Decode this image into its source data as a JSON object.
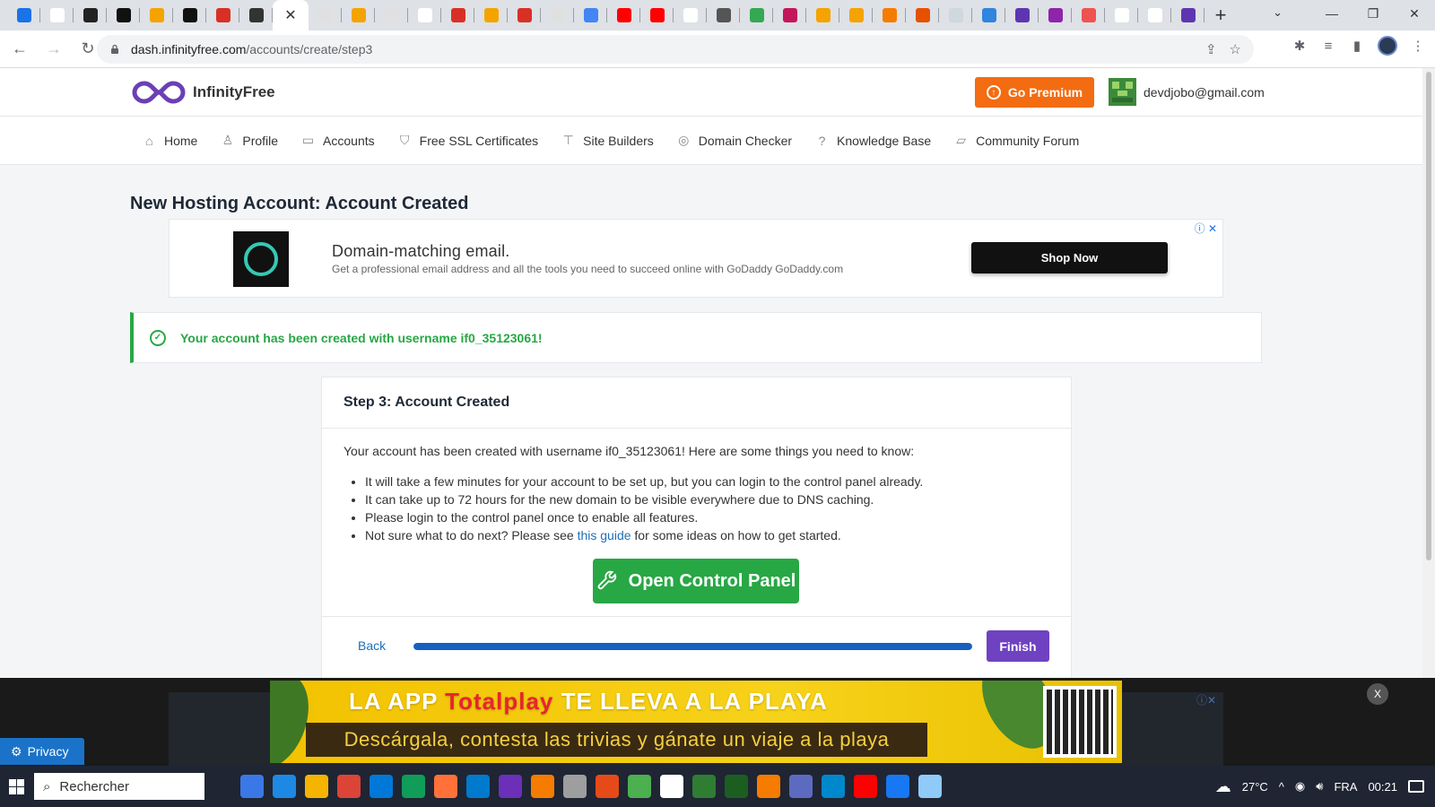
{
  "browser": {
    "tab_colors": [
      "#1a73e8",
      "#ffffff",
      "#222222",
      "#111111",
      "#f4a300",
      "#111111",
      "#d93025",
      "#333333",
      "#e0e0e0",
      "#f4a300",
      "#e0e0e0",
      "#ffffff",
      "#d93025",
      "#f4a300",
      "#d93025",
      "#e0e0e0",
      "#4285f4",
      "#ff0000",
      "#ff0000",
      "#ffffff",
      "#555555",
      "#34a853",
      "#c2185b",
      "#f4a300",
      "#f4a300",
      "#f57c00",
      "#e65100",
      "#cfd8dc",
      "#2e86de",
      "#5e35b1",
      "#8e24aa",
      "#ef5350",
      "#ffffff",
      "#ffffff",
      "#5e35b1"
    ],
    "active_tab_close": "✕",
    "url_domain": "dash.infinityfree.com",
    "url_path": "/accounts/create/step3"
  },
  "header": {
    "logo_text": "InfinityFree",
    "premium_label": "Go Premium",
    "user_email": "devdjobo@gmail.com"
  },
  "nav": {
    "items": [
      {
        "label": "Home",
        "icon": "home-icon"
      },
      {
        "label": "Profile",
        "icon": "user-icon"
      },
      {
        "label": "Accounts",
        "icon": "server-icon"
      },
      {
        "label": "Free SSL Certificates",
        "icon": "shield-icon"
      },
      {
        "label": "Site Builders",
        "icon": "paint-roller-icon"
      },
      {
        "label": "Domain Checker",
        "icon": "check-circle-icon"
      },
      {
        "label": "Knowledge Base",
        "icon": "question-circle-icon"
      },
      {
        "label": "Community Forum",
        "icon": "chat-icon"
      }
    ]
  },
  "page_title": "New Hosting Account: Account Created",
  "ad_top": {
    "headline": "Domain-matching email.",
    "subtext": "Get a professional email address and all the tools you need to succeed online with GoDaddy GoDaddy.com",
    "button": "Shop Now",
    "choices": "ⓘ ✕"
  },
  "alert": {
    "message": "Your account has been created with username if0_35123061!"
  },
  "card": {
    "title": "Step 3: Account Created",
    "intro": "Your account has been created with username if0_35123061! Here are some things you need to know:",
    "bullets": [
      "It will take a few minutes for your account to be set up, but you can login to the control panel already.",
      "It can take up to 72 hours for the new domain to be visible everywhere due to DNS caching.",
      "Please login to the control panel once to enable all features."
    ],
    "last_bullet_pre": "Not sure what to do next? Please see ",
    "last_bullet_link": "this guide",
    "last_bullet_post": " for some ideas on how to get started.",
    "cta": "Open Control Panel",
    "back": "Back",
    "finish": "Finish",
    "progress": 1.0
  },
  "bottom_ad": {
    "headline_pre": "LA APP ",
    "brand": "Totalplay",
    "headline_post": " TE LLEVA A LA PLAYA",
    "subline": "Descárgala, contesta las trivias y gánate un viaje a la playa",
    "close": "X",
    "choices": "ⓘ✕"
  },
  "privacy_label": "Privacy",
  "taskbar": {
    "search_placeholder": "Rechercher",
    "temperature": "27°C",
    "language": "FRA",
    "time": "00:21",
    "app_colors": [
      "#3b78e7",
      "#1e88e5",
      "#f4b400",
      "#db4437",
      "#0078d7",
      "#0f9d58",
      "#ff7139",
      "#007acc",
      "#6b2fba",
      "#f57c00",
      "#9e9e9e",
      "#e64a19",
      "#4caf50",
      "#ffffff",
      "#2e7d32",
      "#1b5e20",
      "#f57c00",
      "#5c6bc0",
      "#0088cc",
      "#ff0000",
      "#1877f2",
      "#90caf9"
    ]
  }
}
